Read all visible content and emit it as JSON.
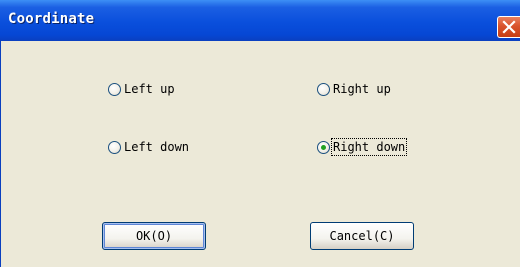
{
  "window": {
    "title": "Coordinate",
    "close_icon": "close-icon"
  },
  "options": [
    {
      "label": "Left up",
      "checked": false
    },
    {
      "label": "Right up",
      "checked": false
    },
    {
      "label": "Left down",
      "checked": false
    },
    {
      "label": "Right down",
      "checked": true
    }
  ],
  "buttons": {
    "ok_label": "OK(O)",
    "cancel_label": "Cancel(C)"
  },
  "colors": {
    "titlebar": "#0a4fdc",
    "close_button": "#d9532c",
    "dialog_background": "#ece9d8",
    "radio_selected_dot": "#21a121"
  }
}
